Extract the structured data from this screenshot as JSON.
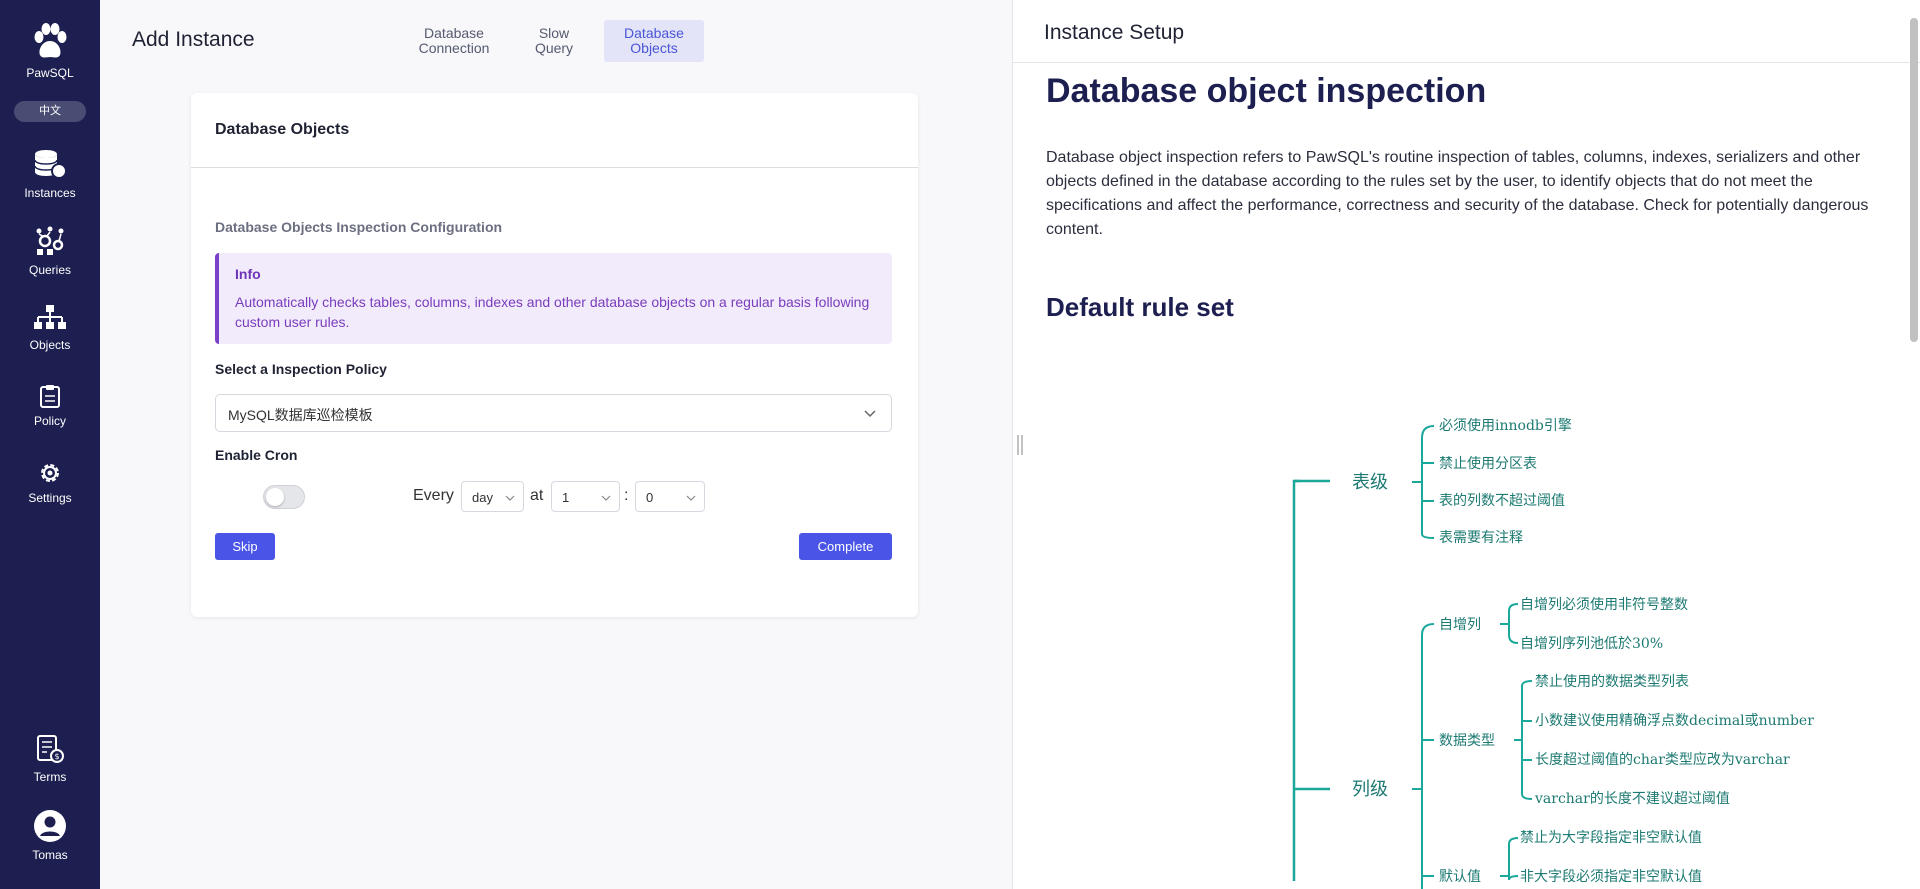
{
  "sidebar": {
    "brand": "PawSQL",
    "language": "中文",
    "items": [
      {
        "label": "Instances",
        "icon": "database-icon"
      },
      {
        "label": "Queries",
        "icon": "queries-icon"
      },
      {
        "label": "Objects",
        "icon": "hierarchy-icon"
      },
      {
        "label": "Policy",
        "icon": "clipboard-icon"
      },
      {
        "label": "Settings",
        "icon": "gear-icon"
      }
    ],
    "bottom": [
      {
        "label": "Terms",
        "icon": "terms-icon"
      },
      {
        "label": "Tomas",
        "icon": "user-avatar-icon"
      }
    ]
  },
  "header": {
    "title": "Add Instance",
    "tabs": [
      {
        "line1": "Database",
        "line2": "Connection"
      },
      {
        "line1": "Slow",
        "line2": "Query"
      },
      {
        "line1": "Database",
        "line2": "Objects"
      }
    ]
  },
  "card": {
    "title": "Database Objects",
    "section_label": "Database Objects Inspection Configuration",
    "info_title": "Info",
    "info_text": "Automatically checks tables, columns, indexes and other database objects on a regular basis following custom user rules.",
    "policy_label": "Select a Inspection Policy",
    "policy_value": "MySQL数据库巡检模板",
    "cron_label": "Enable Cron",
    "every_label": "Every",
    "freq_value": "day",
    "at_label": "at",
    "hour_value": "1",
    "colon": ":",
    "minute_value": "0",
    "skip_label": "Skip",
    "complete_label": "Complete"
  },
  "panel": {
    "header": "Instance Setup",
    "h1": "Database object inspection",
    "paragraph": "Database object inspection refers to PawSQL's routine inspection of tables, columns, indexes, serializers and other objects defined in the database according to the rules set by the user, to identify objects that do not meet the specifications and affect the performance, correctness and security of the database. Check for potentially dangerous content.",
    "h2": "Default rule set",
    "mindmap": {
      "table_level": "表级",
      "table_rules": [
        "必须使用innodb引擎",
        "禁止使用分区表",
        "表的列数不超过阈值",
        "表需要有注释"
      ],
      "column_level": "列级",
      "auto_inc": "自增列",
      "auto_inc_rules": [
        "自增列必须使用非符号整数",
        "自增列序列池低於30%"
      ],
      "data_type": "数据类型",
      "data_type_rules": [
        "禁止使用的数据类型列表",
        "小数建议使用精确浮点数decimal或number",
        "长度超过阈值的char类型应改为varchar",
        "varchar的长度不建议超过阈值"
      ],
      "default_value": "默认值",
      "default_rules": [
        "禁止为大字段指定非空默认值",
        "非大字段必须指定非空默认值"
      ]
    }
  },
  "colors": {
    "sidebar": "#1c1f4f",
    "accent": "#4a55e8",
    "info": "#7b3fc8",
    "mindmap": "#1aa89a"
  }
}
